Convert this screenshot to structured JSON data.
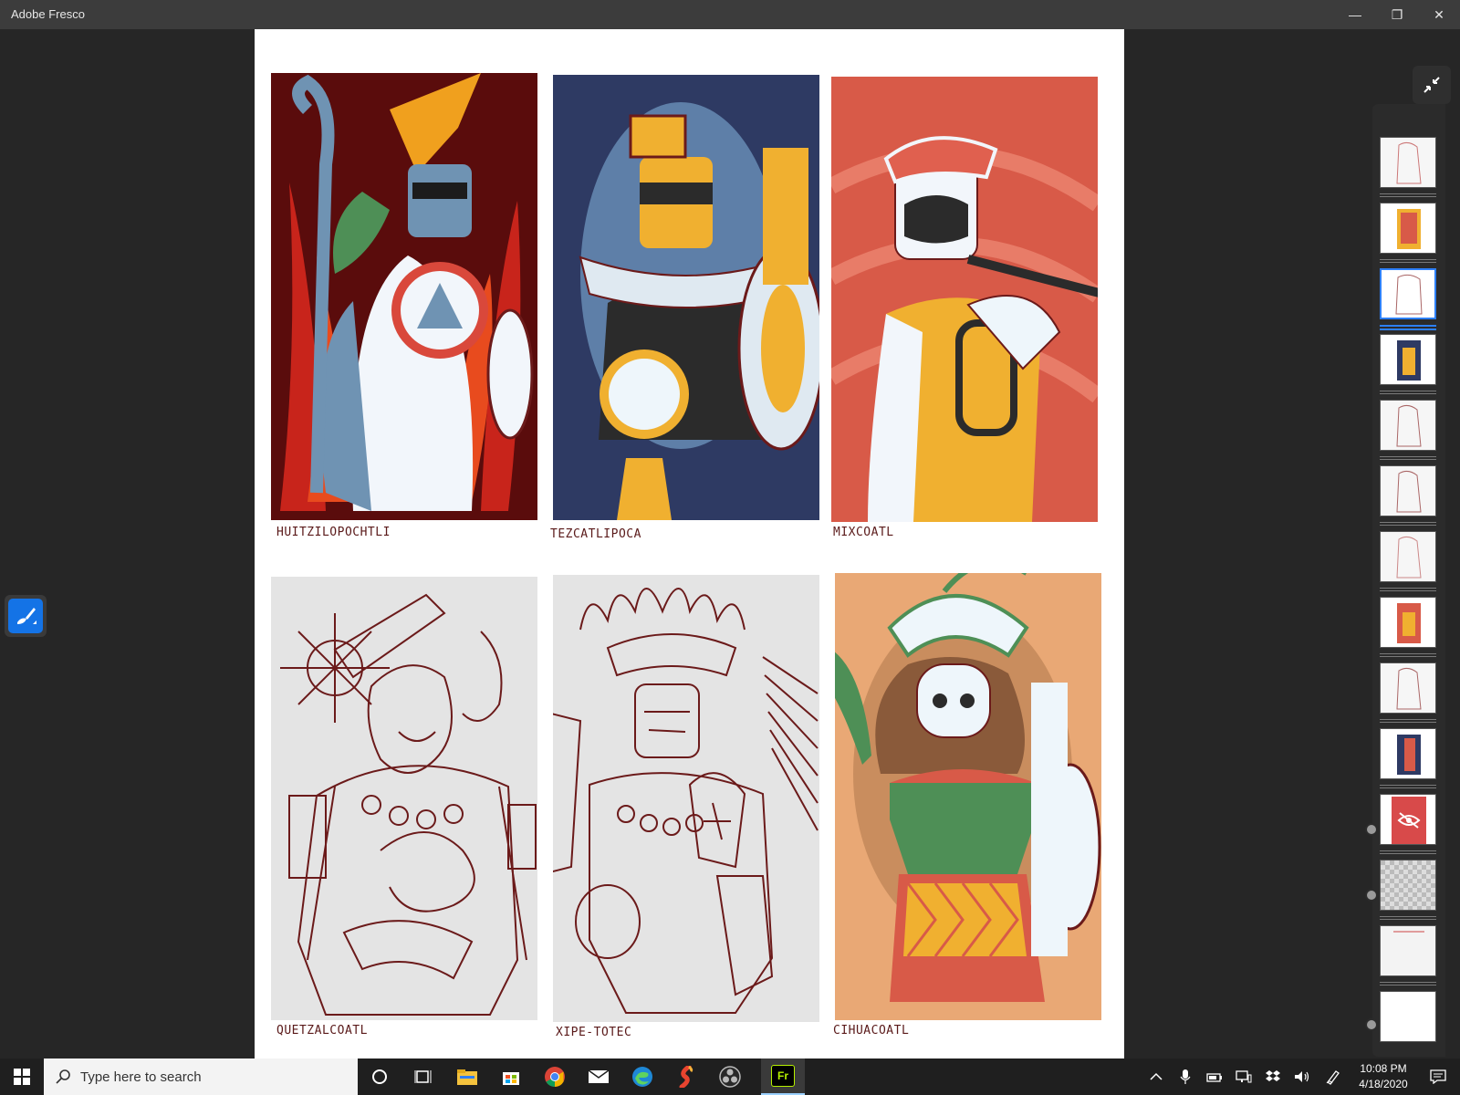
{
  "window": {
    "title": "Adobe Fresco",
    "minimize_glyph": "—",
    "maximize_glyph": "❐",
    "close_glyph": "✕"
  },
  "canvas": {
    "captions": [
      "HUITZILOPOCHTLI",
      "TEZCATLIPOCA",
      "MIXCOATL",
      "QUETZALCOATL",
      "XIPE-TOTEC",
      "CIHUACOATL"
    ]
  },
  "tools": {
    "active_tool_icon": "brush-icon"
  },
  "layers": {
    "count": 14,
    "selected_index": 2,
    "hidden_layer_icon": "eye-hidden-icon"
  },
  "taskbar": {
    "search_placeholder": "Type here to search",
    "time": "10:08 PM",
    "date": "4/18/2020",
    "apps": [
      "cortana-icon",
      "task-view-icon",
      "file-explorer-icon",
      "store-icon",
      "chrome-icon",
      "mail-icon",
      "edge-icon",
      "sketchbook-icon",
      "obs-icon",
      "fresco-icon"
    ],
    "fresco_label": "Fr"
  },
  "colors": {
    "accent": "#1473e6",
    "selection": "#2d7ff9",
    "line_art": "#6b1a1a"
  }
}
